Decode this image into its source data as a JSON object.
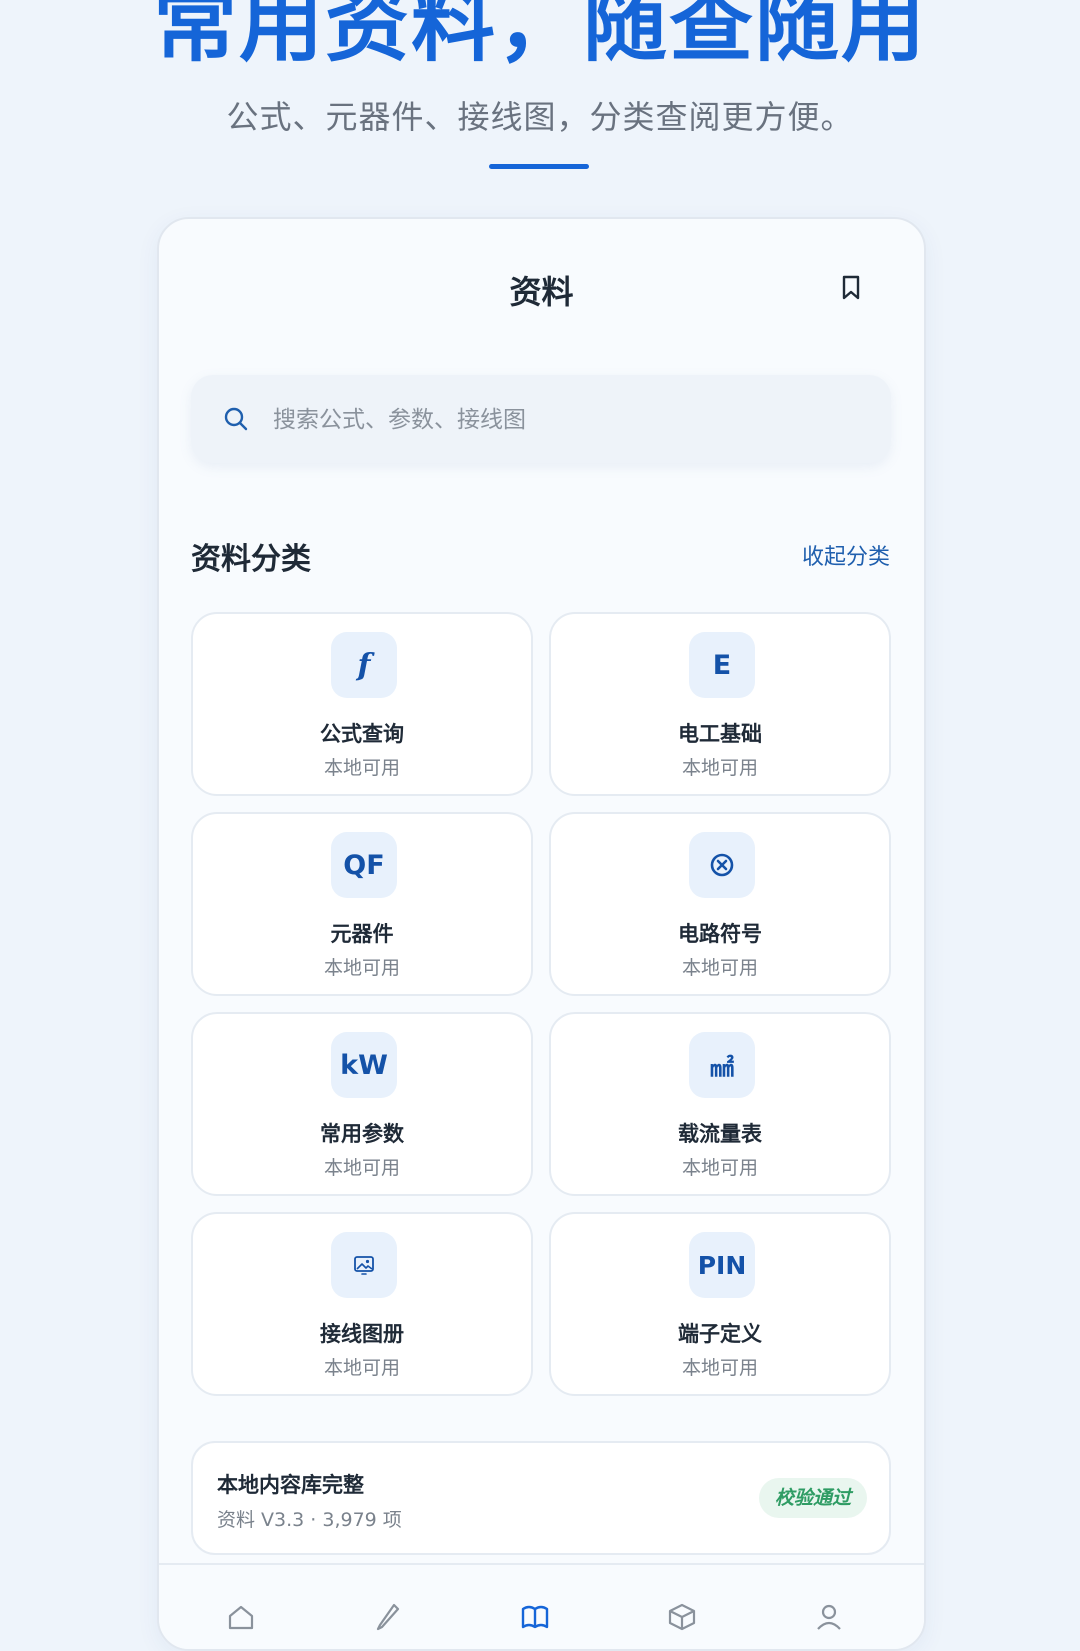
{
  "hero": {
    "title": "常用资料，随查随用",
    "subtitle": "公式、元器件、接线图，分类查阅更方便。",
    "accent_color": "#1565d8"
  },
  "topbar": {
    "title": "资料",
    "bookmark_icon": "bookmark-icon"
  },
  "search": {
    "placeholder": "搜索公式、参数、接线图",
    "icon": "search-icon"
  },
  "section": {
    "title": "资料分类",
    "collapse_label": "收起分类"
  },
  "categories": [
    {
      "icon_text": "f",
      "icon": "formula-icon",
      "title": "公式查询",
      "status": "本地可用"
    },
    {
      "icon_text": "E",
      "icon": "electric-basics-icon",
      "title": "电工基础",
      "status": "本地可用"
    },
    {
      "icon_text": "QF",
      "icon": "breaker-icon",
      "title": "元器件",
      "status": "本地可用"
    },
    {
      "icon_text": "",
      "icon": "circuit-symbol-icon",
      "title": "电路符号",
      "status": "本地可用"
    },
    {
      "icon_text": "kW",
      "icon": "power-icon",
      "title": "常用参数",
      "status": "本地可用"
    },
    {
      "icon_text": "㎟",
      "icon": "cross-section-icon",
      "title": "载流量表",
      "status": "本地可用"
    },
    {
      "icon_text": "",
      "icon": "image-icon",
      "title": "接线图册",
      "status": "本地可用"
    },
    {
      "icon_text": "PIN",
      "icon": "pin-icon",
      "title": "端子定义",
      "status": "本地可用"
    }
  ],
  "status_card": {
    "title": "本地内容库完整",
    "subtitle": "资料 V3.3 · 3,979 项",
    "badge": "校验通过",
    "badge_color": "#2f9c64"
  },
  "tabbar": {
    "icons": [
      "home-icon",
      "tools-icon",
      "library-icon",
      "box-icon",
      "profile-icon"
    ],
    "active_color": "#1565d8"
  }
}
